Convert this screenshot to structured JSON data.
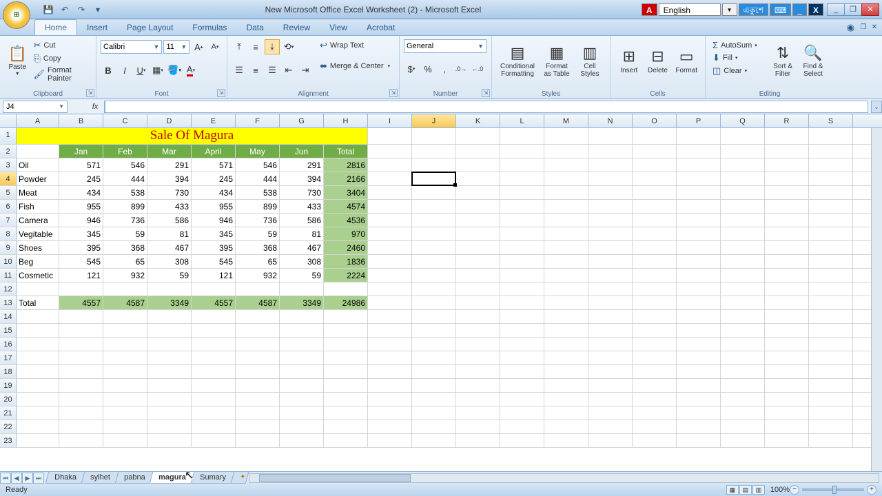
{
  "app_title": "New Microsoft Office Excel Worksheet (2) - Microsoft Excel",
  "language_selector": "English",
  "language_secondary": "একুশে",
  "ribbon_tabs": [
    "Home",
    "Insert",
    "Page Layout",
    "Formulas",
    "Data",
    "Review",
    "View",
    "Acrobat"
  ],
  "active_ribbon_tab": "Home",
  "clipboard": {
    "paste": "Paste",
    "cut": "Cut",
    "copy": "Copy",
    "format_painter": "Format Painter",
    "label": "Clipboard"
  },
  "font": {
    "name": "Calibri",
    "size": "11",
    "label": "Font"
  },
  "alignment": {
    "wrap_text": "Wrap Text",
    "merge_center": "Merge & Center",
    "label": "Alignment"
  },
  "number": {
    "format": "General",
    "label": "Number"
  },
  "styles": {
    "conditional": "Conditional\nFormatting",
    "as_table": "Format\nas Table",
    "cell_styles": "Cell\nStyles",
    "label": "Styles"
  },
  "cells": {
    "insert": "Insert",
    "delete": "Delete",
    "format": "Format",
    "label": "Cells"
  },
  "editing": {
    "autosum": "AutoSum",
    "fill": "Fill",
    "clear": "Clear",
    "sort": "Sort &\nFilter",
    "find": "Find &\nSelect",
    "label": "Editing"
  },
  "name_box": "J4",
  "formula_value": "",
  "columns": [
    "A",
    "B",
    "C",
    "D",
    "E",
    "F",
    "G",
    "H",
    "I",
    "J",
    "K",
    "L",
    "M",
    "N",
    "O",
    "P",
    "Q",
    "R",
    "S"
  ],
  "chart_data": {
    "type": "table",
    "title": "Sale Of Magura",
    "headers": [
      "",
      "Jan",
      "Feb",
      "Mar",
      "April",
      "May",
      "Jun",
      "Total"
    ],
    "rows": [
      {
        "label": "Oil",
        "v": [
          571,
          546,
          291,
          571,
          546,
          291,
          2816
        ]
      },
      {
        "label": "Powder",
        "v": [
          245,
          444,
          394,
          245,
          444,
          394,
          2166
        ]
      },
      {
        "label": "Meat",
        "v": [
          434,
          538,
          730,
          434,
          538,
          730,
          3404
        ]
      },
      {
        "label": "Fish",
        "v": [
          955,
          899,
          433,
          955,
          899,
          433,
          4574
        ]
      },
      {
        "label": "Camera",
        "v": [
          946,
          736,
          586,
          946,
          736,
          586,
          4536
        ]
      },
      {
        "label": "Vegitable",
        "v": [
          345,
          59,
          81,
          345,
          59,
          81,
          970
        ]
      },
      {
        "label": "Shoes",
        "v": [
          395,
          368,
          467,
          395,
          368,
          467,
          2460
        ]
      },
      {
        "label": "Beg",
        "v": [
          545,
          65,
          308,
          545,
          65,
          308,
          1836
        ]
      },
      {
        "label": "Cosmetic",
        "v": [
          121,
          932,
          59,
          121,
          932,
          59,
          2224
        ]
      }
    ],
    "totals_row": {
      "label": "Total",
      "v": [
        4557,
        4587,
        3349,
        4557,
        4587,
        3349,
        24986
      ]
    }
  },
  "sheet_tabs": [
    "Dhaka",
    "sylhet",
    "pabna",
    "magura",
    "Sumary"
  ],
  "active_sheet": "magura",
  "status_text": "Ready",
  "zoom_level": "100%"
}
